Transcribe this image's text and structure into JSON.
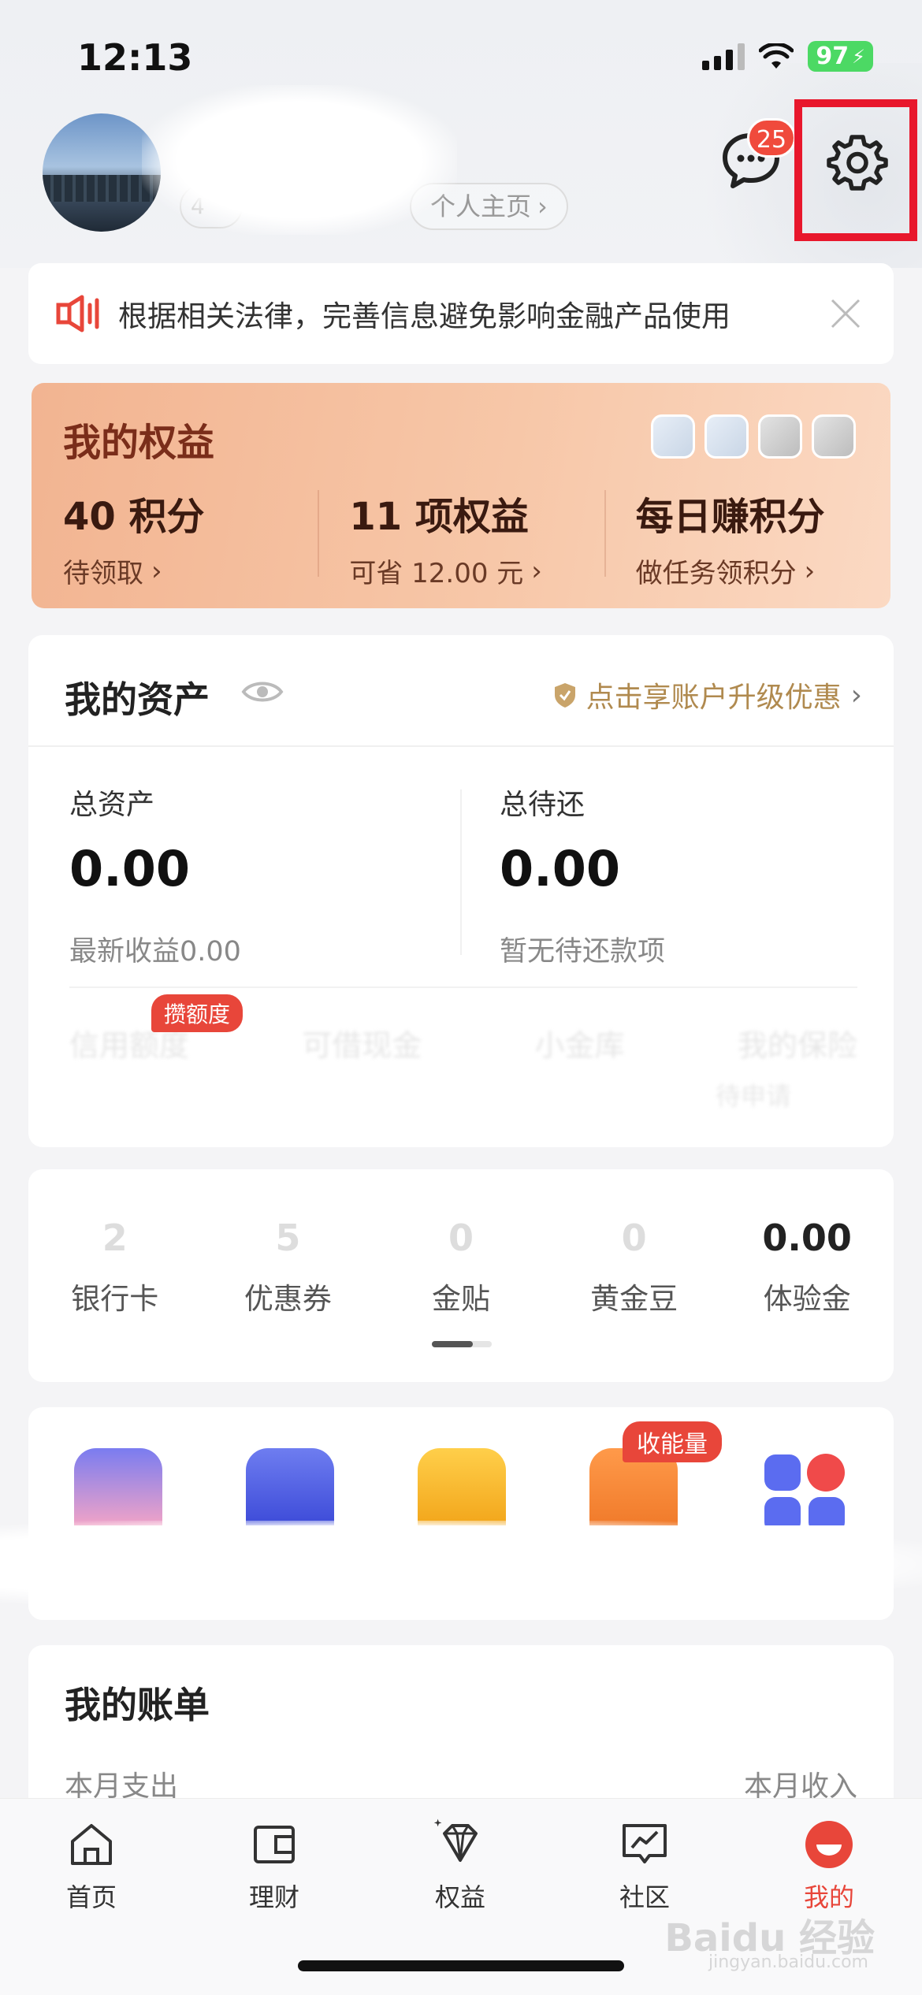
{
  "status_bar": {
    "time": "12:13",
    "battery": "97"
  },
  "profile": {
    "link_label": "个人主页",
    "tag_label": "4"
  },
  "header": {
    "message_badge": "25"
  },
  "notice": {
    "text": "根据相关法律，完善信息避免影响金融产品使用"
  },
  "rights": {
    "title": "我的权益",
    "items": [
      {
        "value": "40 积分",
        "sub": "待领取"
      },
      {
        "value": "11 项权益",
        "sub": "可省 12.00 元"
      },
      {
        "value": "每日赚积分",
        "sub": "做任务领积分"
      }
    ]
  },
  "assets": {
    "title": "我的资产",
    "upgrade": "点击享账户升级优惠",
    "total_label": "总资产",
    "total_value": "0.00",
    "total_sub": "最新收益0.00",
    "repay_label": "总待还",
    "repay_value": "0.00",
    "repay_sub": "暂无待还款项",
    "credit_tag": "攒额度",
    "blurred_items": [
      "信用额度",
      "可借现金",
      "小金库",
      "我的保险"
    ],
    "blurred_sub": "待申请"
  },
  "stats": [
    {
      "value": "2",
      "label": "银行卡"
    },
    {
      "value": "5",
      "label": "优惠券"
    },
    {
      "value": "0",
      "label": "金贴"
    },
    {
      "value": "0",
      "label": "黄金豆"
    },
    {
      "value": "0.00",
      "label": "体验金"
    }
  ],
  "apps": {
    "energy_tag": "收能量"
  },
  "bills": {
    "title": "我的账单",
    "left": "本月支出",
    "right": "本月收入"
  },
  "tabbar": [
    {
      "label": "首页",
      "icon": "home-icon"
    },
    {
      "label": "理财",
      "icon": "wallet-icon"
    },
    {
      "label": "权益",
      "icon": "diamond-icon"
    },
    {
      "label": "社区",
      "icon": "chart-icon"
    },
    {
      "label": "我的",
      "icon": "profile-icon"
    }
  ],
  "watermark": {
    "text": "Baidu 经验",
    "sub": "jingyan.baidu.com"
  },
  "colors": {
    "accent": "#e8463a",
    "highlight_box": "#e8172c",
    "gold": "#b08a4f"
  }
}
